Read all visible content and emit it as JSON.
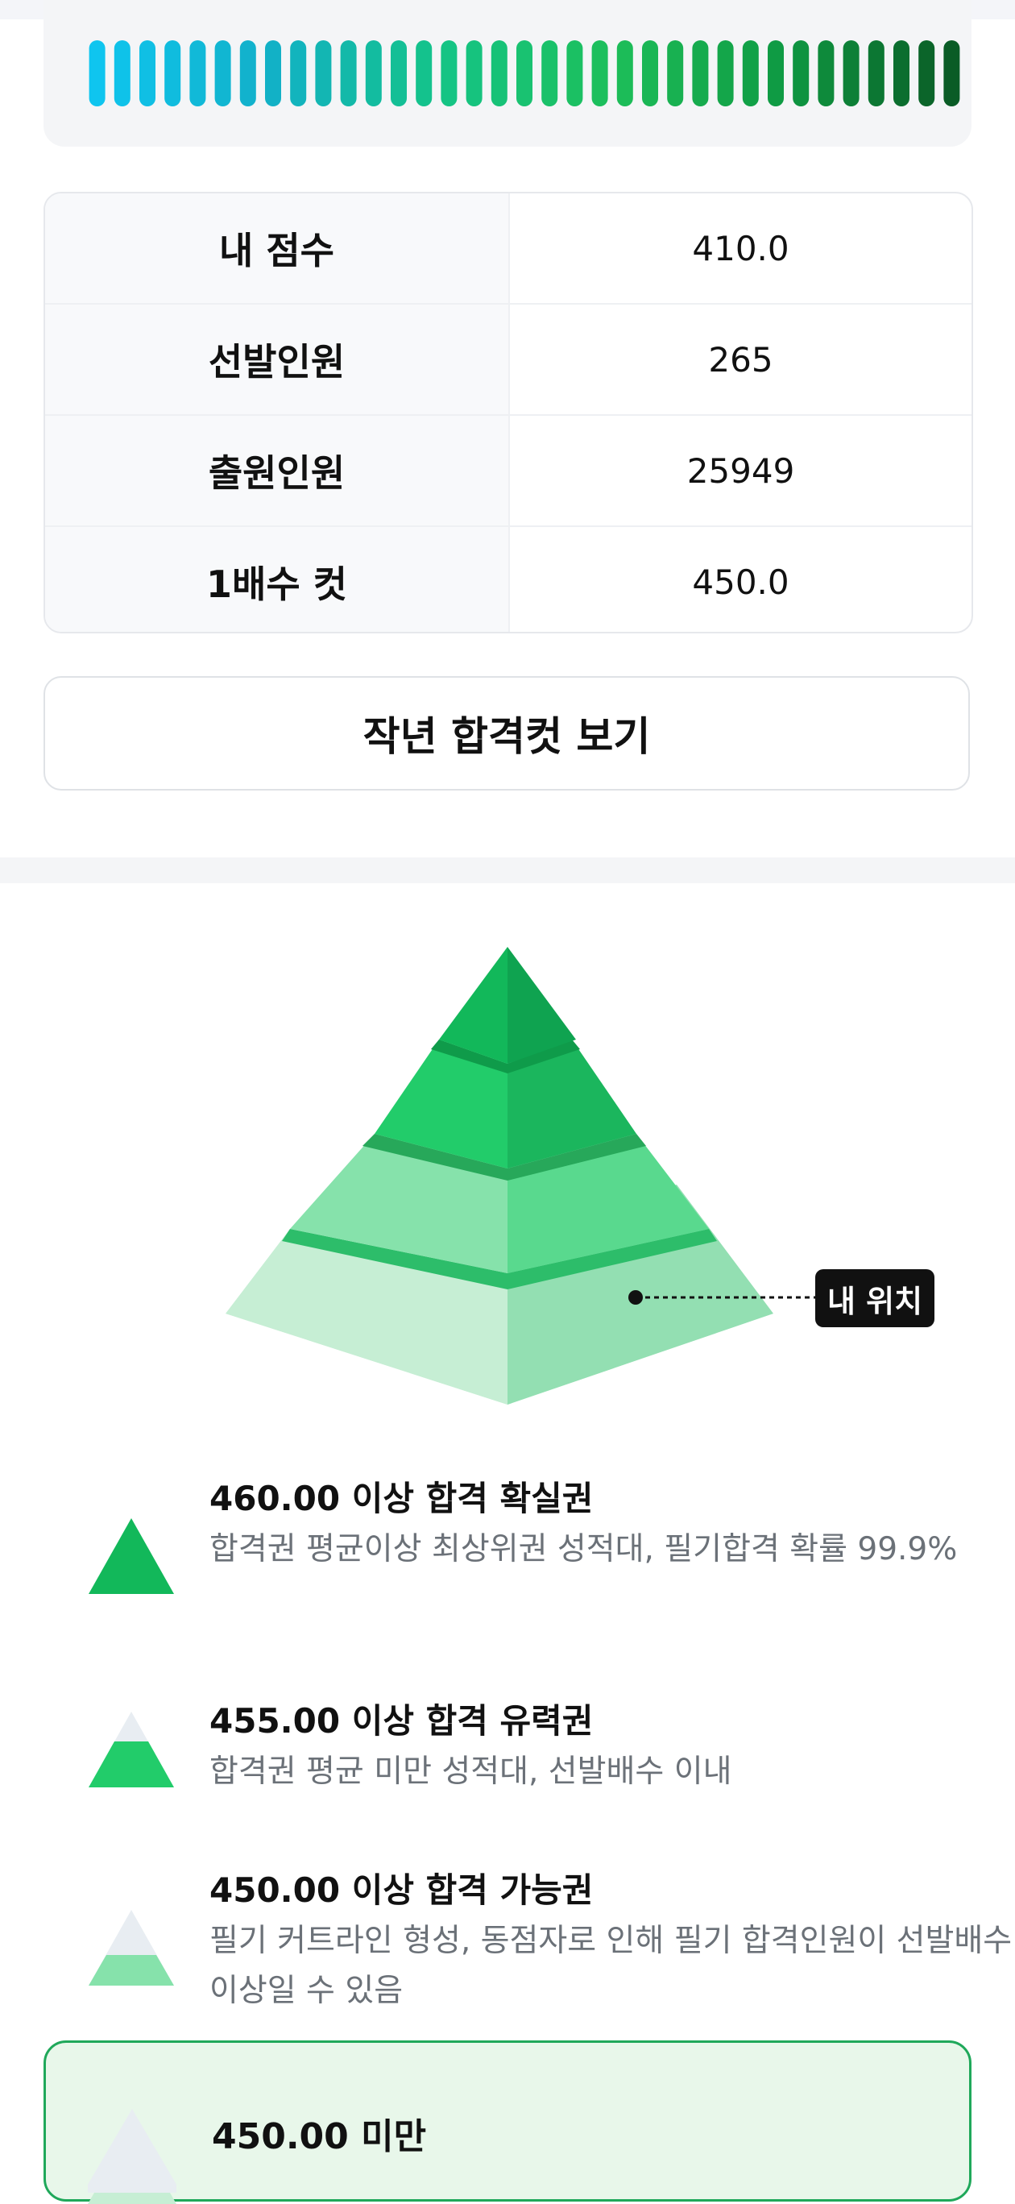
{
  "score_table": {
    "rows": [
      {
        "label": "내 점수",
        "value": "410.0"
      },
      {
        "label": "선발인원",
        "value": "265"
      },
      {
        "label": "출원인원",
        "value": "25949"
      },
      {
        "label": "1배수 컷",
        "value": "450.0"
      }
    ]
  },
  "last_year_button_label": "작년 합격컷 보기",
  "my_position_label": "내 위치",
  "gauge": {
    "bar_count": 35,
    "colors": [
      "#0fc5ef",
      "#12b0c8",
      "#14c487",
      "#1dbf5a",
      "#0f9a43",
      "#0a5c26"
    ]
  },
  "tiers": [
    {
      "title": "460.00 이상 합격 확실권",
      "desc": "합격권 평균이상 최상위권 성적대, 필기합격 확률 99.9%",
      "icon": "pyramid-top-icon"
    },
    {
      "title": "455.00 이상 합격 유력권",
      "desc": "합격권 평균 미만 성적대, 선발배수 이내",
      "icon": "pyramid-upper-icon"
    },
    {
      "title": "450.00 이상 합격 가능권",
      "desc": "필기 커트라인 형성, 동점자로 인해 필기 합격인원이 선발배수 이상일 수 있음",
      "icon": "pyramid-middle-icon"
    },
    {
      "title": "450.00 미만",
      "desc": "",
      "icon": "pyramid-bottom-icon"
    }
  ]
}
